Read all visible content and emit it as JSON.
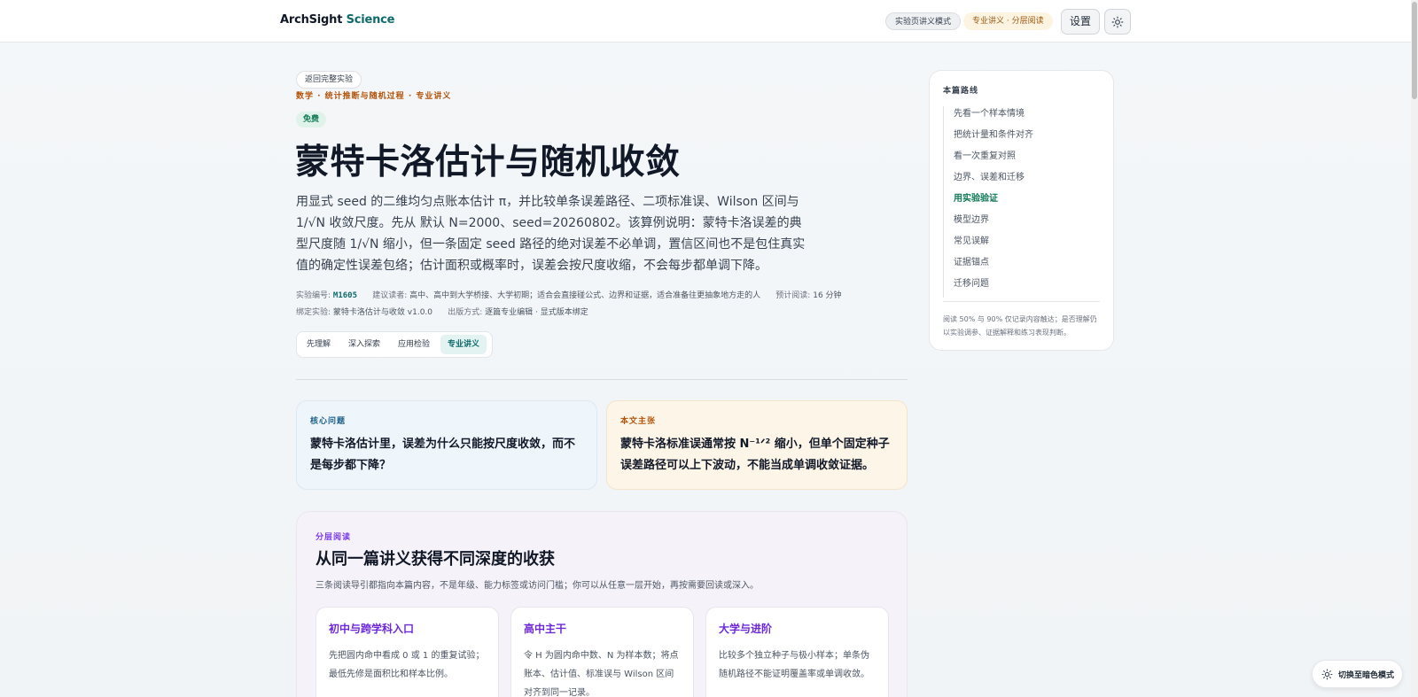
{
  "header": {
    "brand_main": "ArchSight",
    "brand_accent": "Science",
    "mode_pill": "实验页讲义模式",
    "layer_pill": "专业讲义 · 分层阅读",
    "settings_label": "设置"
  },
  "article": {
    "back_label": "返回完整实验",
    "breadcrumb": "数学 · 统计推断与随机过程 · 专业讲义",
    "badge": "免费",
    "title": "蒙特卡洛估计与随机收敛",
    "lead": "用显式 seed 的二维均匀点账本估计 π，并比较单条误差路径、二项标准误、Wilson 区间与 1/√N 收敛尺度。先从 默认 N=2000、seed=20260802。该算例说明：蒙特卡洛误差的典型尺度随 1/√N 缩小，但一条固定 seed 路径的绝对误差不必单调，置信区间也不是包住真实值的确定性误差包络；估计面积或概率时，误差会按尺度收缩，不会每步都单调下降。",
    "meta": {
      "id_key": "实验编号:",
      "id_val": "M1605",
      "reader_key": "建议读者:",
      "reader_val": "高中、高中到大学桥接、大学初期；适合会直接碰公式、边界和证据，适合准备往更抽象地方走的人",
      "time_key": "预计阅读:",
      "time_val": "16 分钟",
      "bind_key": "绑定实验:",
      "bind_val": "蒙特卡洛估计与收敛 v1.0.0",
      "pub_key": "出版方式:",
      "pub_val": "逐篇专业编辑 · 显式版本绑定"
    },
    "tabs": [
      {
        "label": "先理解"
      },
      {
        "label": "深入探索"
      },
      {
        "label": "应用检验"
      },
      {
        "label": "专业讲义"
      }
    ],
    "core": {
      "label": "核心问题",
      "text": "蒙特卡洛估计里，误差为什么只能按尺度收敛，而不是每步都下降？"
    },
    "claim": {
      "label": "本文主张",
      "text": "蒙特卡洛标准误通常按 N⁻¹ᐟ² 缩小，但单个固定种子误差路径可以上下波动，不能当成单调收敛证据。"
    },
    "layered": {
      "label": "分层阅读",
      "title": "从同一篇讲义获得不同深度的收获",
      "desc": "三条阅读导引都指向本篇内容，不是年级、能力标签或访问门槛；你可以从任意一层开始，再按需要回读或深入。",
      "cards": [
        {
          "title": "初中与跨学科入口",
          "text": "先把圆内命中看成 0 或 1 的重复试验；最低先修是面积比和样本比例。"
        },
        {
          "title": "高中主干",
          "text": "令 H 为圆内命中数、N 为样本数；将点账本、估计值、标准误与 Wilson 区间对齐到同一记录。"
        },
        {
          "title": "大学与进阶",
          "text": "比较多个独立种子与极小样本；单条伪随机路径不能证明覆盖率或单调收敛。"
        }
      ]
    }
  },
  "toc": {
    "title": "本篇路线",
    "items": [
      "先看一个样本情境",
      "把统计量和条件对齐",
      "看一次重复对照",
      "边界、误差和迁移",
      "用实验验证",
      "模型边界",
      "常见误解",
      "证据锚点",
      "迁移问题"
    ],
    "active_index": 4,
    "note": "阅读 50% 与 90% 仅记录内容触达；是否理解仍以实验调参、证据解释和练习表现判断。"
  },
  "dark_toggle_label": "切换至暗色模式"
}
